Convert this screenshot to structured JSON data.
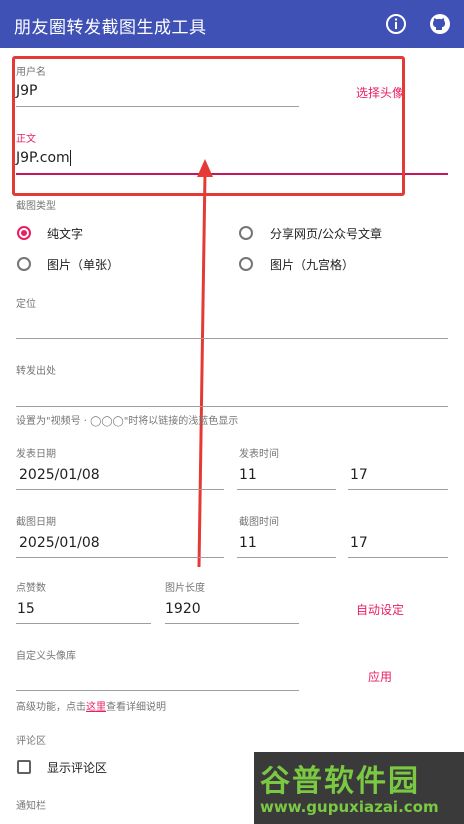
{
  "app": {
    "title": "朋友圈转发截图生成工具"
  },
  "toolbar": {
    "info_icon": "info-icon",
    "github_icon": "github-icon"
  },
  "username": {
    "label": "用户名",
    "value": "J9P",
    "choose_avatar": "选择头像"
  },
  "body_text": {
    "label": "正文",
    "value": "J9P.com"
  },
  "screenshot_type": {
    "label": "截图类型",
    "options": [
      "纯文字",
      "分享网页/公众号文章",
      "图片（单张）",
      "图片（九宫格）"
    ],
    "selected": "纯文字"
  },
  "location": {
    "label": "定位",
    "value": ""
  },
  "forward_source": {
    "label": "转发出处",
    "value": "",
    "hint": "设置为\"视频号 · ◯◯◯\"时将以链接的浅蓝色显示"
  },
  "publish": {
    "date_label": "发表日期",
    "date": "2025/01/08",
    "time_label": "发表时间",
    "hour": "11",
    "minute": "17"
  },
  "capture": {
    "date_label": "截图日期",
    "date": "2025/01/08",
    "time_label": "截图时间",
    "hour": "11",
    "minute": "17"
  },
  "likes": {
    "label": "点赞数",
    "value": "15"
  },
  "image_length": {
    "label": "图片长度",
    "value": "1920",
    "auto_button": "自动设定"
  },
  "avatar_lib": {
    "label": "自定义头像库",
    "value": "",
    "apply_button": "应用"
  },
  "advanced_hint": {
    "prefix": "高级功能，点击",
    "link": "这里",
    "suffix": "查看详细说明"
  },
  "comments": {
    "label": "评论区",
    "checkbox_label": "显示评论区"
  },
  "notification": {
    "label": "通知栏"
  },
  "watermark": {
    "main": "谷普软件园",
    "url": "www.gupuxiazai.com"
  }
}
